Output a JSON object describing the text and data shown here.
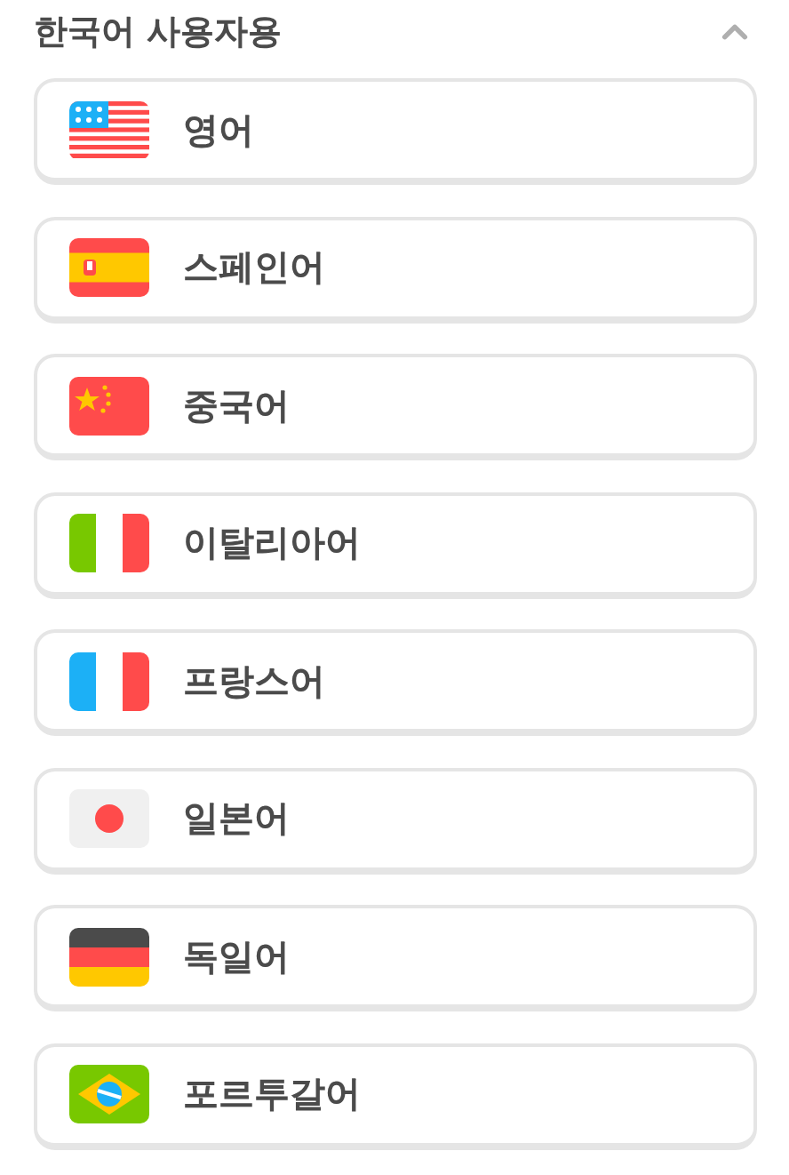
{
  "section": {
    "title": "한국어 사용자용",
    "expanded": true
  },
  "languages": [
    {
      "label": "영어",
      "kind": "us"
    },
    {
      "label": "스페인어",
      "kind": "es"
    },
    {
      "label": "중국어",
      "kind": "cn"
    },
    {
      "label": "이탈리아어",
      "kind": "it"
    },
    {
      "label": "프랑스어",
      "kind": "fr"
    },
    {
      "label": "일본어",
      "kind": "jp"
    },
    {
      "label": "독일어",
      "kind": "de"
    },
    {
      "label": "포르투갈어",
      "kind": "br"
    }
  ]
}
